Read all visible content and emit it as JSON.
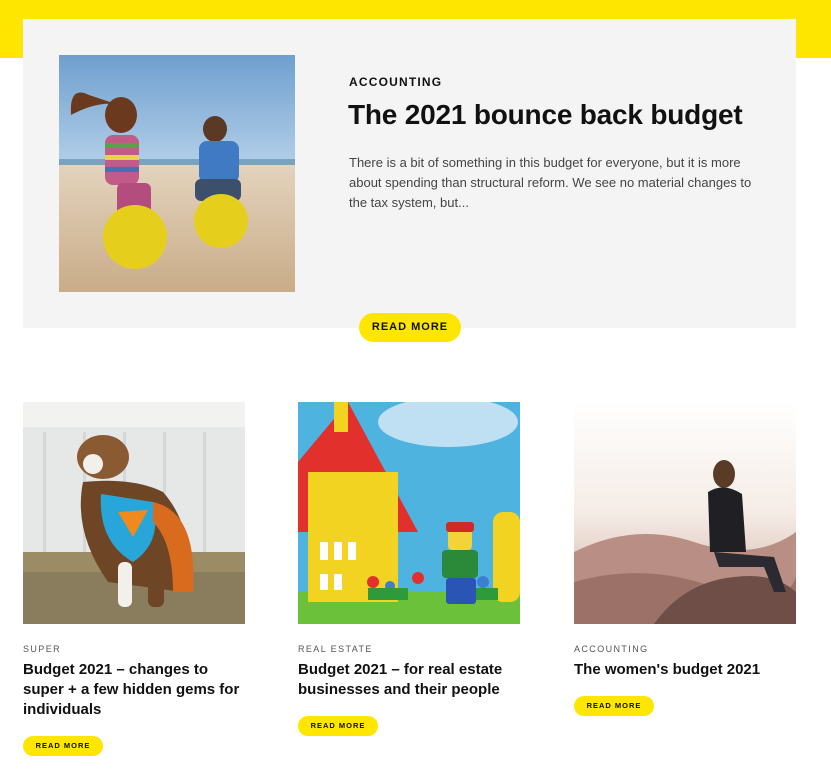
{
  "featured": {
    "category": "ACCOUNTING",
    "title": "The 2021 bounce back budget",
    "excerpt": "There is a bit of something in this budget for everyone, but it is more about spending than structural reform. We see no material changes to the tax system, but...",
    "read_more_label": "READ MORE",
    "image_alt": "children-bouncing-on-beach-photo"
  },
  "posts": [
    {
      "category": "SUPER",
      "title": "Budget 2021 – changes to super + a few hidden gems for individuals",
      "read_more_label": "READ MORE",
      "image_alt": "dog-superhero-costume-photo"
    },
    {
      "category": "REAL ESTATE",
      "title": "Budget 2021 – for real estate businesses and their people",
      "read_more_label": "READ MORE",
      "image_alt": "lego-house-figure-photo"
    },
    {
      "category": "ACCOUNTING",
      "title": "The women's budget 2021",
      "read_more_label": "READ MORE",
      "image_alt": "woman-on-mountain-photo"
    }
  ],
  "colors": {
    "accent": "#ffe600",
    "panel": "#f4f4f4",
    "text": "#111111"
  }
}
